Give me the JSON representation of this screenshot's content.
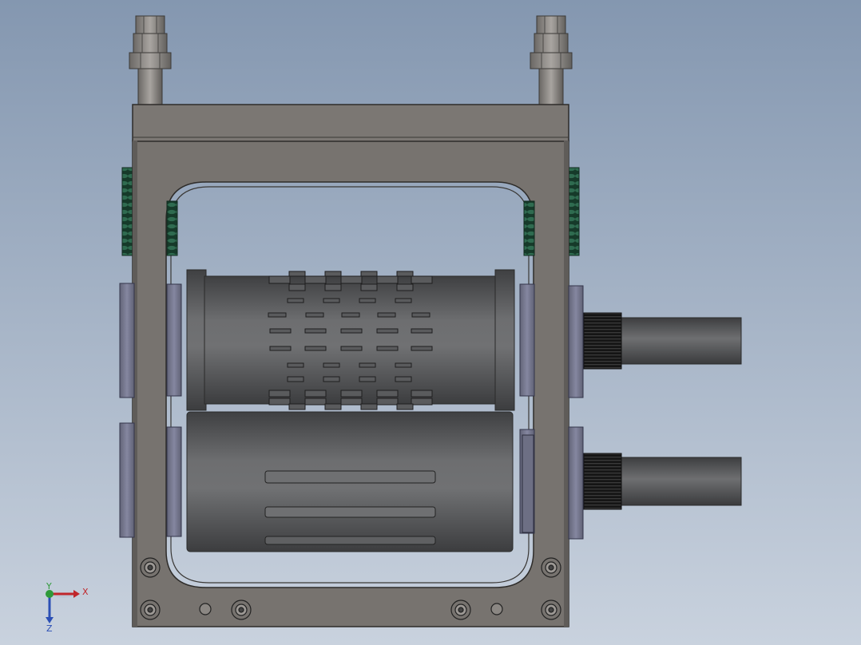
{
  "viewport": {
    "background_top": "#8497b0",
    "background_bottom": "#c9d2de"
  },
  "model": {
    "frame_color": "#7a7672",
    "frame_dark": "#4f4c49",
    "roller_color": "#5e5f61",
    "spring_color": "#1f4a37",
    "end_plate_color": "#7a7c92",
    "shaft_color": "#55575a",
    "thread_color": "#1b1b1b",
    "nut_color": "#8a8784"
  },
  "triad": {
    "x_label": "X",
    "y_label": "Y",
    "z_label": "Z",
    "x_color": "#c0262b",
    "y_color": "#2f9a3a",
    "z_color": "#2c4fb5"
  }
}
